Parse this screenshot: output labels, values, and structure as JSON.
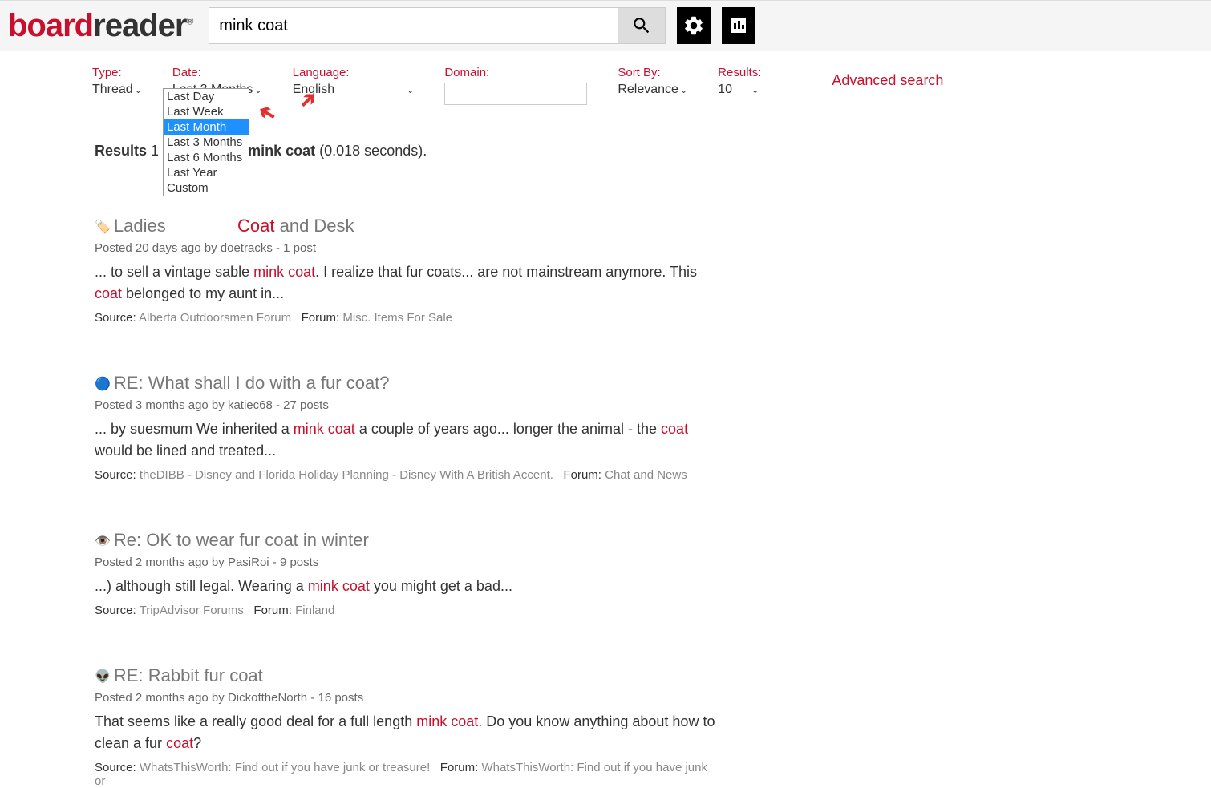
{
  "logo": {
    "part1": "board",
    "part2": "reader",
    "reg": "®"
  },
  "search": {
    "value": "mink coat"
  },
  "filters": {
    "type": {
      "label": "Type:",
      "value": "Thread"
    },
    "date": {
      "label": "Date:",
      "value": "Last 3 Months"
    },
    "language": {
      "label": "Language:",
      "value": "English"
    },
    "domain": {
      "label": "Domain:"
    },
    "sort": {
      "label": "Sort By:",
      "value": "Relevance"
    },
    "results": {
      "label": "Results:",
      "value": "10"
    }
  },
  "date_dropdown": [
    "Last Day",
    "Last Week",
    "Last Month",
    "Last 3 Months",
    "Last 6 Months",
    "Last Year",
    "Custom"
  ],
  "date_dropdown_selected": "Last Month",
  "advanced": "Advanced search",
  "results_summary": {
    "prefix": "Results",
    "range": "1 -",
    "query": "mink coat",
    "time": "(0.018 seconds)."
  },
  "results": [
    {
      "title_prefix": "Ladies",
      "title_mid": "",
      "title_hl": "Coat",
      "title_suffix": " and Desk",
      "posted": "Posted 20 days ago by ",
      "author": "doetracks",
      "posts": " - 1 post",
      "snippet1": "... to sell a vintage sable ",
      "snippet_hl1": "mink coat",
      "snippet2": ". I realize that fur coats... are not mainstream anymore. This ",
      "snippet_hl2": "coat",
      "snippet3": " belonged to my aunt in...",
      "source_label": "Source: ",
      "source": "Alberta Outdoorsmen Forum",
      "forum_label": "Forum: ",
      "forum": "Misc. Items For Sale"
    },
    {
      "title_full": "RE: What shall I do with a fur coat?",
      "posted": "Posted 3 months ago by ",
      "author": "katiec68",
      "posts": " - 27 posts",
      "snippet1": "... by suesmum We inherited a ",
      "snippet_hl1": "mink coat",
      "snippet2": " a couple of years ago... longer the animal - the ",
      "snippet_hl2": "coat",
      "snippet3": " would be lined and treated...",
      "source_label": "Source: ",
      "source": "theDIBB - Disney and Florida Holiday Planning - Disney With A British Accent.",
      "forum_label": "Forum: ",
      "forum": "Chat and News"
    },
    {
      "title_full": "Re: OK to wear fur coat in winter",
      "posted": "Posted 2 months ago by ",
      "author": "PasiRoi",
      "posts": " - 9 posts",
      "snippet1": "...) although still legal. Wearing a ",
      "snippet_hl1": "mink coat",
      "snippet2": " you might get a bad...",
      "snippet_hl2": "",
      "snippet3": "",
      "source_label": "Source: ",
      "source": "TripAdvisor Forums",
      "forum_label": "Forum: ",
      "forum": "Finland"
    },
    {
      "title_full": "RE: Rabbit fur coat",
      "posted": "Posted 2 months ago by ",
      "author": "DickoftheNorth",
      "posts": " - 16 posts",
      "snippet1": "That seems like a really good deal for a full length ",
      "snippet_hl1": "mink coat",
      "snippet2": ". Do you know anything about how to clean a fur ",
      "snippet_hl2": "coat",
      "snippet3": "?",
      "source_label": "Source: ",
      "source": "WhatsThisWorth: Find out if you have junk or treasure!",
      "forum_label": "Forum: ",
      "forum": "WhatsThisWorth: Find out if you have junk or"
    }
  ]
}
